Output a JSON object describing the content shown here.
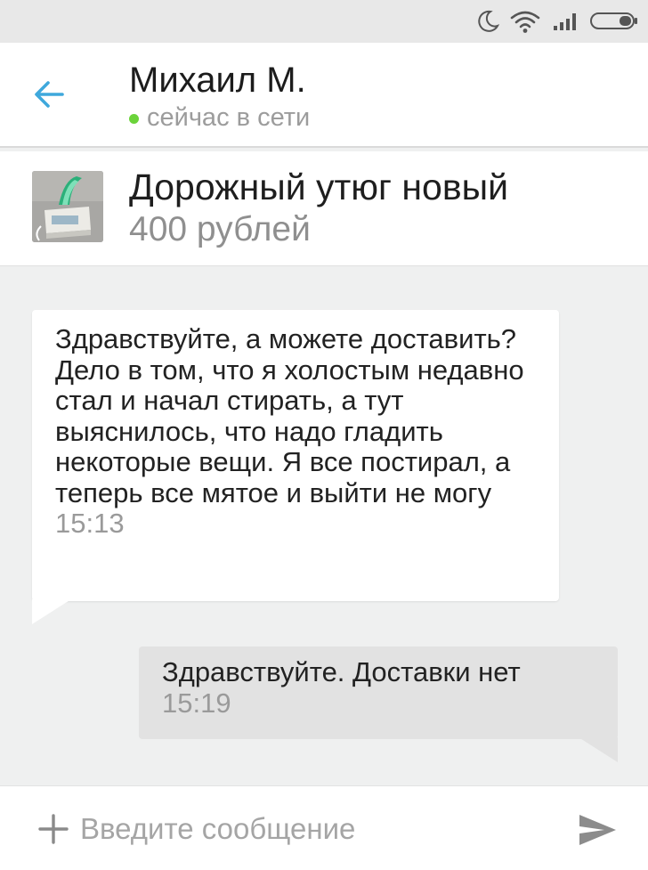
{
  "status_bar": {
    "icons": [
      "moon-icon",
      "wifi-icon",
      "signal-icon",
      "battery-icon"
    ]
  },
  "header": {
    "back_icon": "arrow-left-icon",
    "contact_name": "Михаил М.",
    "presence": "сейчас в сети",
    "presence_color": "#6bd33a",
    "accent_color": "#3fa8dc"
  },
  "listing": {
    "thumbnail": "iron-photo",
    "title": "Дорожный утюг новый",
    "price": "400 рублей"
  },
  "messages": [
    {
      "direction": "incoming",
      "text": "Здравствуйте, а можете доставить? Дело в том, что я холостым недавно стал и начал стирать, а тут выяснилось, что надо гладить некоторые вещи. Я все постирал, а теперь все мятое и выйти не могу",
      "time": "15:13"
    },
    {
      "direction": "outgoing",
      "text": "Здравствуйте. Доставки нет",
      "time": "15:19"
    }
  ],
  "composer": {
    "attach_icon": "plus-icon",
    "placeholder": "Введите сообщение",
    "value": "",
    "send_icon": "send-icon"
  }
}
